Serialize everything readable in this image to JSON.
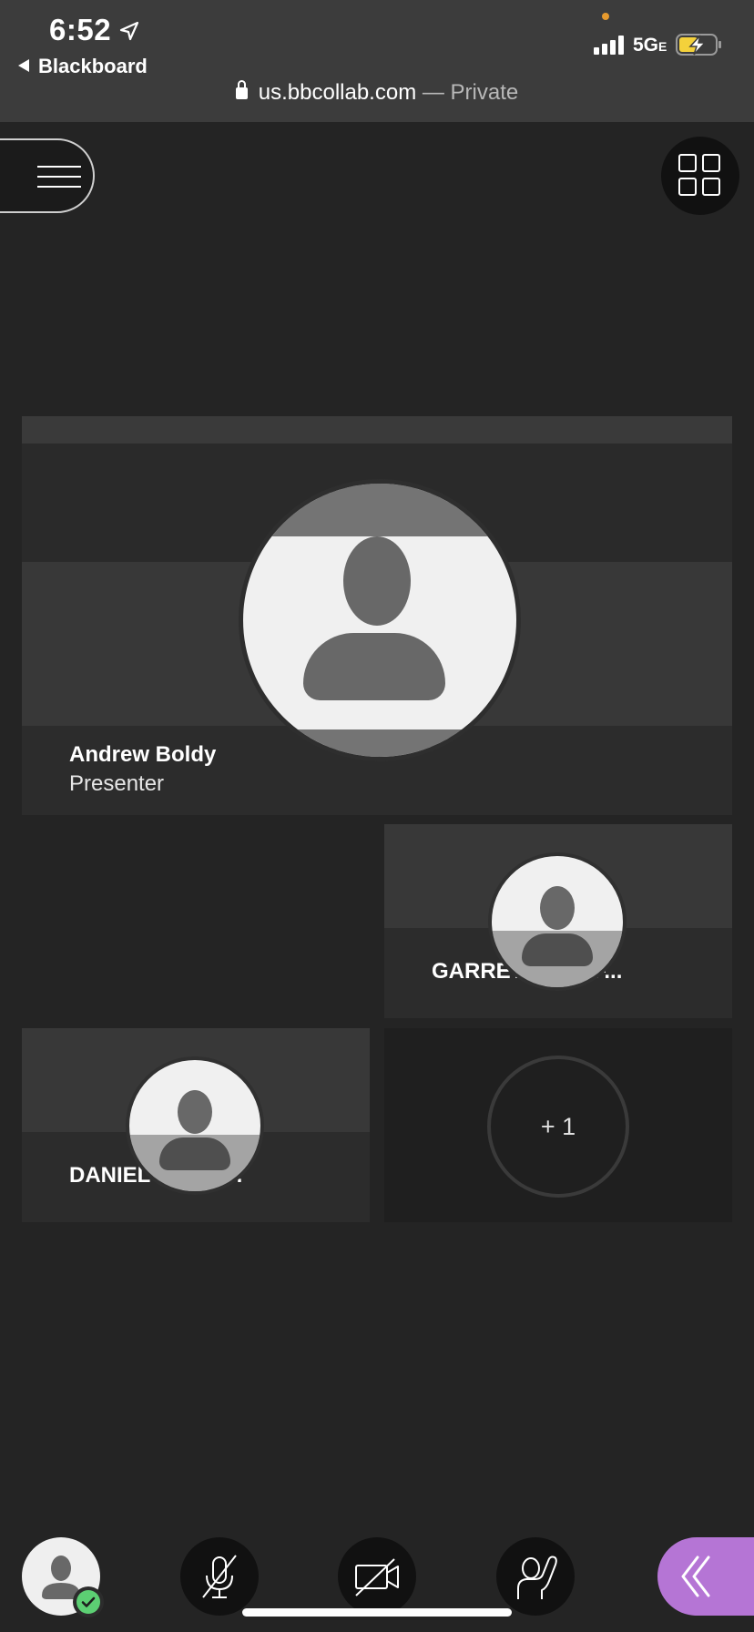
{
  "status_bar": {
    "time": "6:52",
    "back_app": "Blackboard",
    "network": "5G",
    "network_suffix": "E"
  },
  "url_bar": {
    "domain": "us.bbcollab.com",
    "mode": " — Private"
  },
  "participants": {
    "presenter": {
      "name": "Andrew Boldy",
      "role": "Presenter"
    },
    "tile2": {
      "name": "GARRETT RAY F..."
    },
    "tile3": {
      "name": "DANIEL WINST..."
    },
    "overflow_count": "+ 1"
  },
  "colors": {
    "background": "#242424",
    "tile": "#383838",
    "collab_panel_button": "#b575d5",
    "presence_available": "#5ccf73"
  },
  "icons": {
    "menu": "hamburger-icon",
    "layout": "grid-layout-icon",
    "microphone": "microphone-muted-icon",
    "camera": "camera-off-icon",
    "hand": "raise-hand-icon",
    "panel": "double-chevron-left-icon"
  }
}
